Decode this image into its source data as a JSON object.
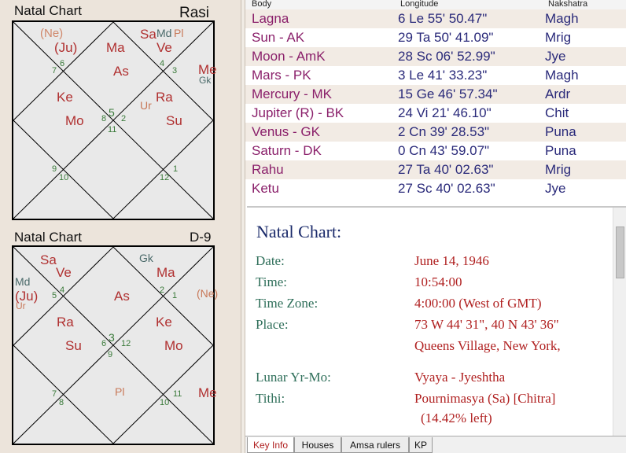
{
  "rasi_chart": {
    "title": "Natal Chart",
    "division": "Rasi",
    "planets": [
      "(Ne)",
      "(Ju)",
      "Ma",
      "Sa",
      "Md",
      "Pl",
      "Ve",
      "Me",
      "Gk",
      "As",
      "Ke",
      "Ra",
      "Mo",
      "Su",
      "Ur"
    ],
    "houses": [
      "6",
      "7",
      "4",
      "3",
      "5",
      "2",
      "8",
      "11",
      "9",
      "10",
      "1",
      "12"
    ]
  },
  "d9_chart": {
    "title": "Natal Chart",
    "division": "D-9",
    "planets": [
      "Sa",
      "Ve",
      "Gk",
      "Ma",
      "Md",
      "(Ju)",
      "Ur",
      "As",
      "(Ne)",
      "Ra",
      "Ke",
      "Su",
      "Mo",
      "Pl",
      "Me"
    ],
    "houses": [
      "5",
      "4",
      "2",
      "1",
      "3",
      "6",
      "12",
      "9",
      "7",
      "8",
      "11",
      "10"
    ]
  },
  "table": {
    "headers": [
      "Body",
      "Longitude",
      "Nakshatra"
    ],
    "rows": [
      {
        "body": "Lagna",
        "longitude": "6 Le 55' 50.47\"",
        "nakshatra": "Magh"
      },
      {
        "body": "Sun - AK",
        "longitude": "29 Ta 50' 41.09\"",
        "nakshatra": "Mrig"
      },
      {
        "body": "Moon - AmK",
        "longitude": "28 Sc 06' 52.99\"",
        "nakshatra": "Jye"
      },
      {
        "body": "Mars - PK",
        "longitude": "3 Le 41' 33.23\"",
        "nakshatra": "Magh"
      },
      {
        "body": "Mercury - MK",
        "longitude": "15 Ge 46' 57.34\"",
        "nakshatra": "Ardr"
      },
      {
        "body": "Jupiter (R) - BK",
        "longitude": "24 Vi 21' 46.10\"",
        "nakshatra": "Chit"
      },
      {
        "body": "Venus - GK",
        "longitude": "2 Cn 39' 28.53\"",
        "nakshatra": "Puna"
      },
      {
        "body": "Saturn - DK",
        "longitude": "0 Cn 43' 59.07\"",
        "nakshatra": "Puna"
      },
      {
        "body": "Rahu",
        "longitude": "27 Ta 40' 02.63\"",
        "nakshatra": "Mrig"
      },
      {
        "body": "Ketu",
        "longitude": "27 Sc 40' 02.63\"",
        "nakshatra": "Jye"
      }
    ]
  },
  "info": {
    "title": "Natal Chart:",
    "date_label": "Date:",
    "date": "June 14, 1946",
    "time_label": "Time:",
    "time": "10:54:00",
    "tz_label": "Time Zone:",
    "tz": "4:00:00 (West of GMT)",
    "place_label": "Place:",
    "place_coords": "73 W 44' 31\", 40 N 43' 36\"",
    "place_name": "Queens Village, New York,",
    "lunar_label": "Lunar Yr-Mo:",
    "lunar": "Vyaya - Jyeshtha",
    "tithi_label": "Tithi:",
    "tithi": "Pournimasya (Sa) [Chitra]",
    "tithi_left": "(14.42% left)"
  },
  "tabs": [
    "Key Info",
    "Houses",
    "Amsa rulers",
    "KP"
  ],
  "colors": {
    "planet": "#b03030",
    "house_number": "#3a7a3a",
    "body_text": "#8a1f6a",
    "info_label": "#2f6f5a",
    "info_value": "#b02020"
  }
}
